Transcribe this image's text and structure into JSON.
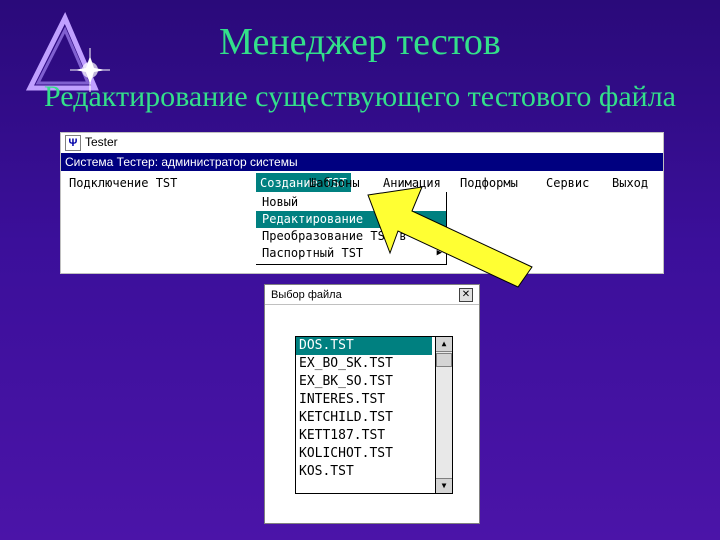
{
  "slide": {
    "title": "Менеджер тестов",
    "subtitle": "Редактирование существующего тестового файла"
  },
  "colors": {
    "heading": "#33e08a",
    "selection": "#008080",
    "system_bar": "#000080"
  },
  "tester_window": {
    "title": "Tester",
    "icon_glyph": "Ψ",
    "system_line": "Система Тестер: администратор системы",
    "menu": [
      {
        "label": "Подключение TST"
      },
      {
        "label": "Создание TST"
      },
      {
        "label": "Шаблоны"
      },
      {
        "label": "Анимация"
      },
      {
        "label": "Подформы"
      },
      {
        "label": "Сервис"
      },
      {
        "label": "Выход"
      }
    ],
    "dropdown": [
      {
        "label": "Новый"
      },
      {
        "label": "Редактирование"
      },
      {
        "label": "Преобразование TST в TXT"
      },
      {
        "label": "Паспортный TST",
        "submenu_glyph": "▶"
      }
    ]
  },
  "file_dialog": {
    "title": "Выбор файла",
    "close_glyph": "✕",
    "files": [
      "DOS.TST",
      "EX_BO_SK.TST",
      "EX_BK_SO.TST",
      "INTERES.TST",
      "KETCHILD.TST",
      "KETT187.TST",
      "KOLICHOT.TST",
      "KOS.TST"
    ],
    "scroll_up_glyph": "▲",
    "scroll_down_glyph": "▼"
  }
}
